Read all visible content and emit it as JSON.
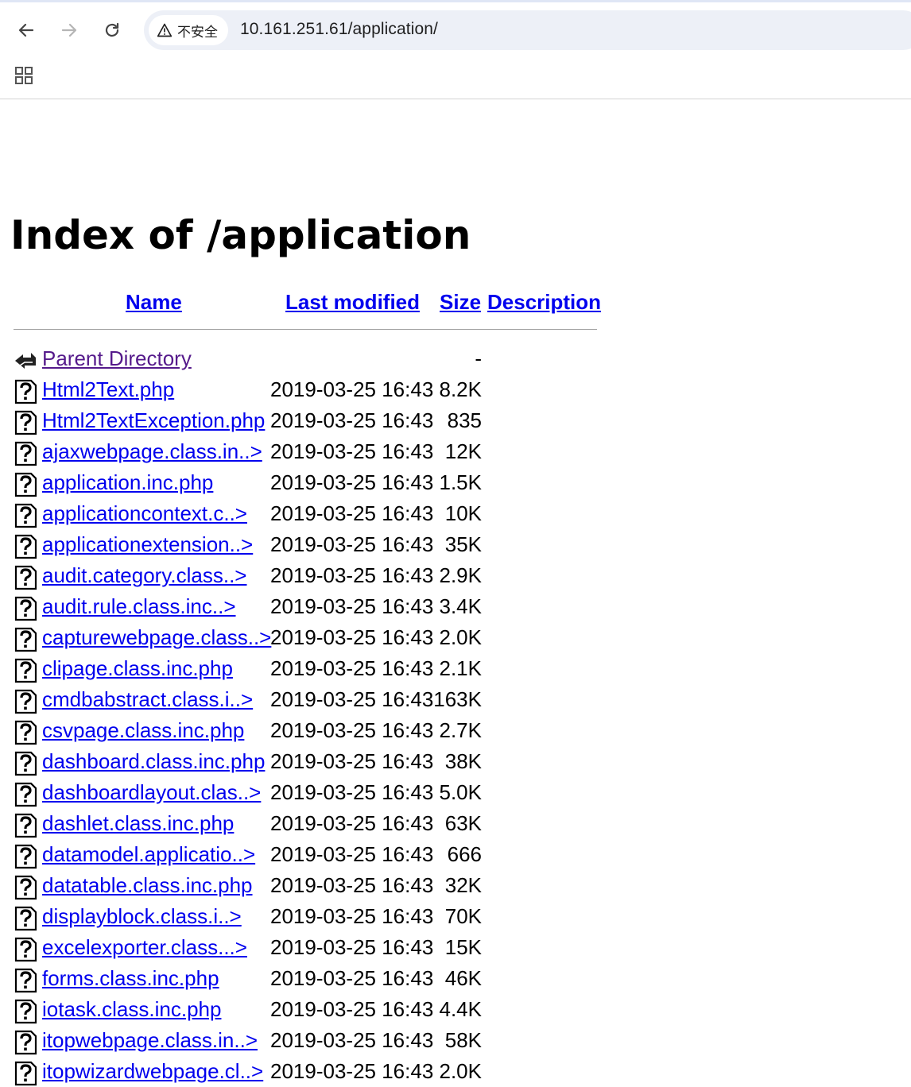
{
  "browser": {
    "security_label": "不安全",
    "url": "10.161.251.61/application/"
  },
  "page": {
    "title": "Index of /application",
    "columns": {
      "name": "Name",
      "last_modified": "Last modified",
      "size": "Size",
      "description": "Description"
    },
    "parent": {
      "name": "Parent Directory",
      "size": "-"
    },
    "rows": [
      {
        "name": "Html2Text.php",
        "modified": "2019-03-25 16:43",
        "size": "8.2K"
      },
      {
        "name": "Html2TextException.php",
        "modified": "2019-03-25 16:43",
        "size": "835"
      },
      {
        "name": "ajaxwebpage.class.in..>",
        "modified": "2019-03-25 16:43",
        "size": "12K"
      },
      {
        "name": "application.inc.php",
        "modified": "2019-03-25 16:43",
        "size": "1.5K"
      },
      {
        "name": "applicationcontext.c..>",
        "modified": "2019-03-25 16:43",
        "size": "10K"
      },
      {
        "name": "applicationextension..>",
        "modified": "2019-03-25 16:43",
        "size": "35K"
      },
      {
        "name": "audit.category.class..>",
        "modified": "2019-03-25 16:43",
        "size": "2.9K"
      },
      {
        "name": "audit.rule.class.inc..>",
        "modified": "2019-03-25 16:43",
        "size": "3.4K"
      },
      {
        "name": "capturewebpage.class..>",
        "modified": "2019-03-25 16:43",
        "size": "2.0K"
      },
      {
        "name": "clipage.class.inc.php",
        "modified": "2019-03-25 16:43",
        "size": "2.1K"
      },
      {
        "name": "cmdbabstract.class.i..>",
        "modified": "2019-03-25 16:43",
        "size": "163K"
      },
      {
        "name": "csvpage.class.inc.php",
        "modified": "2019-03-25 16:43",
        "size": "2.7K"
      },
      {
        "name": "dashboard.class.inc.php",
        "modified": "2019-03-25 16:43",
        "size": "38K"
      },
      {
        "name": "dashboardlayout.clas..>",
        "modified": "2019-03-25 16:43",
        "size": "5.0K"
      },
      {
        "name": "dashlet.class.inc.php",
        "modified": "2019-03-25 16:43",
        "size": "63K"
      },
      {
        "name": "datamodel.applicatio..>",
        "modified": "2019-03-25 16:43",
        "size": "666"
      },
      {
        "name": "datatable.class.inc.php",
        "modified": "2019-03-25 16:43",
        "size": "32K"
      },
      {
        "name": "displayblock.class.i..>",
        "modified": "2019-03-25 16:43",
        "size": "70K"
      },
      {
        "name": "excelexporter.class...>",
        "modified": "2019-03-25 16:43",
        "size": "15K"
      },
      {
        "name": "forms.class.inc.php",
        "modified": "2019-03-25 16:43",
        "size": "46K"
      },
      {
        "name": "iotask.class.inc.php",
        "modified": "2019-03-25 16:43",
        "size": "4.4K"
      },
      {
        "name": "itopwebpage.class.in..>",
        "modified": "2019-03-25 16:43",
        "size": "58K"
      },
      {
        "name": "itopwizardwebpage.cl..>",
        "modified": "2019-03-25 16:43",
        "size": "2.0K"
      }
    ]
  }
}
